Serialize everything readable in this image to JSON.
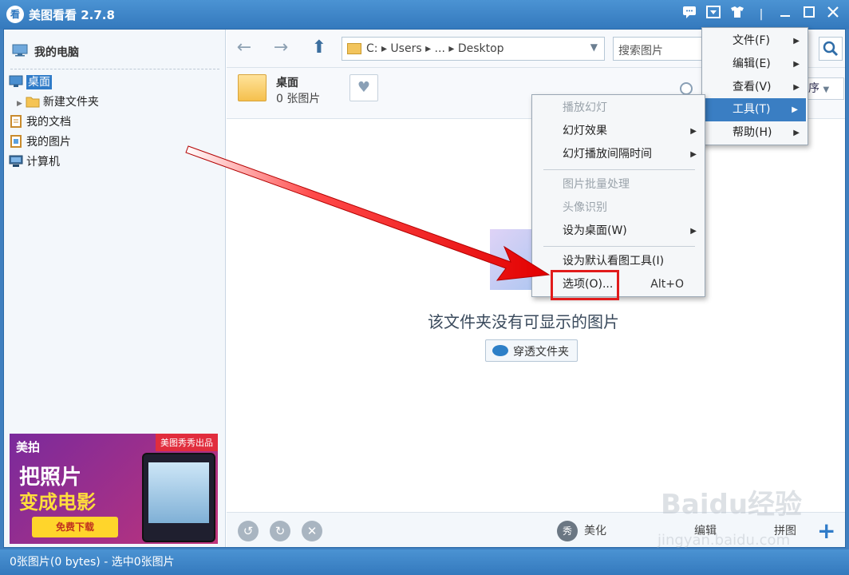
{
  "window": {
    "logo_text": "看",
    "title": "美图看看 2.7.8"
  },
  "sidebar": {
    "title": "我的电脑",
    "tree": [
      {
        "label": "桌面",
        "selected": true
      },
      {
        "label": "新建文件夹"
      },
      {
        "label": "我的文档"
      },
      {
        "label": "我的图片"
      },
      {
        "label": "计算机"
      }
    ]
  },
  "ad": {
    "brand": "美拍",
    "badge": "美图秀秀出品",
    "headline1": "把照片",
    "headline2": "变成电影",
    "button": "免费下载"
  },
  "toolbar": {
    "back": "←",
    "forward": "→",
    "up": "⬆",
    "path": "C: ▸ Users ▸ ... ▸ Desktop",
    "search_placeholder": "搜索图片"
  },
  "folder": {
    "name": "桌面",
    "count": "0 张图片",
    "sort_label": "序"
  },
  "content": {
    "empty_message": "该文件夹没有可显示的图片",
    "pass_button": "穿透文件夹"
  },
  "bottombar": {
    "beautify_icon": "秀",
    "beautify": "美化",
    "edit": "编辑",
    "puzzle": "拼图",
    "add": "+"
  },
  "status": {
    "text": "0张图片(0 bytes) - 选中0张图片"
  },
  "main_menu": {
    "items": [
      {
        "label": "文件(F)",
        "submenu": true
      },
      {
        "label": "编辑(E)",
        "submenu": true
      },
      {
        "label": "查看(V)",
        "submenu": true
      },
      {
        "label": "工具(T)",
        "submenu": true,
        "active": true
      },
      {
        "label": "帮助(H)",
        "submenu": true
      }
    ]
  },
  "tools_menu": {
    "items": [
      {
        "label": "播放幻灯",
        "disabled": true
      },
      {
        "label": "幻灯效果",
        "submenu": true
      },
      {
        "label": "幻灯播放间隔时间",
        "submenu": true
      },
      {
        "label": "图片批量处理",
        "disabled": true
      },
      {
        "label": "头像识别",
        "disabled": true
      },
      {
        "label": "设为桌面(W)",
        "submenu": true
      },
      {
        "label": "设为默认看图工具(I)"
      },
      {
        "label": "选项(O)...",
        "accel": "Alt+O"
      }
    ]
  },
  "watermark": {
    "logo": "Baidu经验",
    "url": "jingyan.baidu.com"
  },
  "colors": {
    "titlebar": "#3479bd",
    "accent": "#2f7bc8",
    "highlight": "#e11b1b"
  }
}
